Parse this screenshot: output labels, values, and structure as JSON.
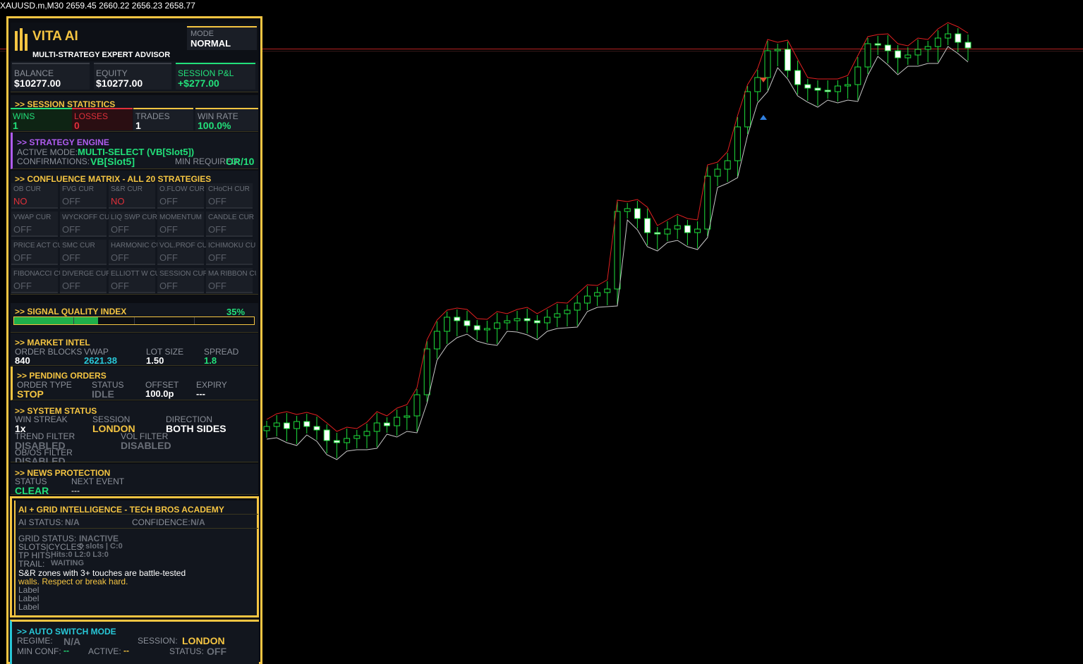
{
  "header": {
    "symbol_line": "XAUUSD.m,M30  2659.45 2660.22 2656.23 2658.77"
  },
  "brand": {
    "name": "VITA AI",
    "subtitle": "MULTI-STRATEGY EXPERT ADVISOR",
    "mode_label": "MODE",
    "mode_value": "NORMAL"
  },
  "account": {
    "balance_label": "BALANCE",
    "balance": "$10277.00",
    "equity_label": "EQUITY",
    "equity": "$10277.00",
    "pnl_label": "SESSION P&L",
    "pnl": "+$277.00"
  },
  "session_stats": {
    "title": ">> SESSION STATISTICS",
    "wins_label": "WINS",
    "wins": "1",
    "losses_label": "LOSSES",
    "losses": "0",
    "trades_label": "TRADES",
    "trades": "1",
    "winrate_label": "WIN RATE",
    "winrate": "100.0%"
  },
  "strategy_engine": {
    "title": ">> STRATEGY ENGINE",
    "active_label": "ACTIVE MODE:",
    "active": "MULTI-SELECT (VB[Slot5])",
    "confirm_label": "CONFIRMATIONS:",
    "confirm": "VB[Slot5]",
    "minreq_label": "MIN REQUIRED:",
    "minreq": "OR/10"
  },
  "confluence": {
    "title": ">> CONFLUENCE MATRIX - ALL 20 STRATEGIES",
    "cells": [
      {
        "name": "OB CUR",
        "state": "NO"
      },
      {
        "name": "FVG CUR",
        "state": "OFF"
      },
      {
        "name": "S&R CUR",
        "state": "NO"
      },
      {
        "name": "O.FLOW CUR",
        "state": "OFF"
      },
      {
        "name": "CHoCH CUR",
        "state": "OFF"
      },
      {
        "name": "VWAP CUR",
        "state": "OFF"
      },
      {
        "name": "WYCKOFF CUR",
        "state": "OFF"
      },
      {
        "name": "LIQ SWP CUR",
        "state": "OFF"
      },
      {
        "name": "MOMENTUM",
        "state": "OFF"
      },
      {
        "name": "CANDLE CUR",
        "state": "OFF"
      },
      {
        "name": "PRICE ACT CUR",
        "state": "OFF"
      },
      {
        "name": "SMC CUR",
        "state": "OFF"
      },
      {
        "name": "HARMONIC CUR",
        "state": "OFF"
      },
      {
        "name": "VOL.PROF CUR",
        "state": "OFF"
      },
      {
        "name": "ICHIMOKU CUR",
        "state": "OFF"
      },
      {
        "name": "FIBONACCI CUR",
        "state": "OFF"
      },
      {
        "name": "DIVERGE CUR",
        "state": "OFF"
      },
      {
        "name": "ELLIOTT W CUR",
        "state": "OFF"
      },
      {
        "name": "SESSION CUR",
        "state": "OFF"
      },
      {
        "name": "MA RIBBON CUR",
        "state": "OFF"
      }
    ]
  },
  "signal_quality": {
    "title": ">> SIGNAL QUALITY INDEX",
    "value": "35%",
    "fraction": 0.35
  },
  "market_intel": {
    "title": ">> MARKET INTEL",
    "ob_label": "ORDER BLOCKS",
    "ob": "840",
    "vwap_label": "VWAP",
    "vwap": "2621.38",
    "lot_label": "LOT SIZE",
    "lot": "1.50",
    "spread_label": "SPREAD",
    "spread": "1.8"
  },
  "pending": {
    "title": ">> PENDING ORDERS",
    "type_label": "ORDER TYPE",
    "type": "STOP",
    "status_label": "STATUS",
    "status": "IDLE",
    "offset_label": "OFFSET",
    "offset": "100.0p",
    "expiry_label": "EXPIRY",
    "expiry": "---"
  },
  "system": {
    "title": ">> SYSTEM STATUS",
    "streak_label": "WIN STREAK",
    "streak": "1x",
    "session_label": "SESSION",
    "session": "LONDON",
    "direction_label": "DIRECTION",
    "direction": "BOTH SIDES",
    "trend_label": "TREND FILTER",
    "trend": "DISABLED",
    "vol_label": "VOL FILTER",
    "vol": "DISABLED",
    "obos_label": "OB/OS FILTER",
    "obos": "DISABLED"
  },
  "news": {
    "title": ">> NEWS PROTECTION",
    "status_label": "STATUS",
    "status": "CLEAR",
    "next_label": "NEXT EVENT",
    "next": "---"
  },
  "ai_grid": {
    "title": "AI + GRID INTELLIGENCE - TECH BROS ACADEMY",
    "ai_status_label": "AI STATUS:",
    "ai_status": "N/A",
    "confidence_label": "CONFIDENCE:",
    "confidence": "N/A",
    "grid_label": "GRID STATUS:",
    "grid": "INACTIVE",
    "slots_label": "SLOTS|CYCLES:",
    "slots": "0 slots | C:0",
    "tp_label": "TP HITS:",
    "tp": "Hits:0 L2:0 L3:0",
    "trail_label": "TRAIL:",
    "trail": "WAITING",
    "tip1": "S&R zones with 3+ touches are battle-tested",
    "tip2": "walls. Respect or break hard.",
    "label1": "Label",
    "label2": "Label",
    "label3": "Label"
  },
  "auto_switch": {
    "title": ">> AUTO SWITCH MODE",
    "regime_label": "REGIME:",
    "regime": "N/A",
    "session_label": "SESSION:",
    "session": "LONDON",
    "minconf_label": "MIN CONF:",
    "minconf": "--",
    "active_label": "ACTIVE:",
    "active": "--",
    "status_label": "STATUS:",
    "status": "OFF"
  }
}
